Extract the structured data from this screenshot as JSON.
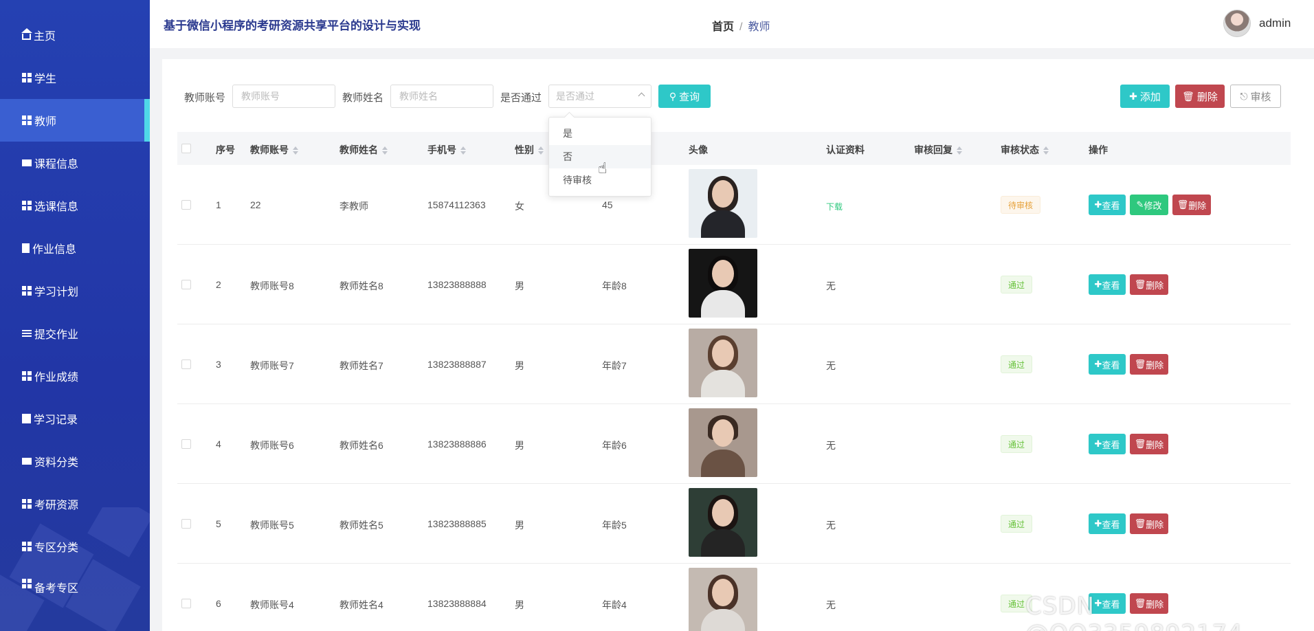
{
  "app": {
    "title": "基于微信小程序的考研资源共享平台的设计与实现",
    "user_name": "admin"
  },
  "breadcrumb": {
    "home": "首页",
    "separator": "/",
    "current": "教师"
  },
  "sidebar": {
    "items": [
      {
        "label": "主页",
        "icon": "home-icon"
      },
      {
        "label": "学生",
        "icon": "grid-icon"
      },
      {
        "label": "教师",
        "icon": "grid-icon",
        "active": true
      },
      {
        "label": "课程信息",
        "icon": "monitor-icon"
      },
      {
        "label": "选课信息",
        "icon": "grid-icon"
      },
      {
        "label": "作业信息",
        "icon": "clipboard-icon"
      },
      {
        "label": "学习计划",
        "icon": "grid-icon"
      },
      {
        "label": "提交作业",
        "icon": "sliders-icon"
      },
      {
        "label": "作业成绩",
        "icon": "grid-icon"
      },
      {
        "label": "学习记录",
        "icon": "book-icon"
      },
      {
        "label": "资料分类",
        "icon": "monitor-icon"
      },
      {
        "label": "考研资源",
        "icon": "grid-icon"
      },
      {
        "label": "专区分类",
        "icon": "grid-icon"
      },
      {
        "label": "备考专区",
        "icon": "grid-icon"
      }
    ]
  },
  "search": {
    "account_label": "教师账号",
    "account_placeholder": "教师账号",
    "name_label": "教师姓名",
    "name_placeholder": "教师姓名",
    "pass_label": "是否通过",
    "pass_placeholder": "是否通过",
    "query_button": "查询",
    "options": [
      "是",
      "否",
      "待审核"
    ]
  },
  "toolbar": {
    "add": "添加",
    "delete": "删除",
    "audit": "审核"
  },
  "table": {
    "columns": [
      "序号",
      "教师账号",
      "教师姓名",
      "手机号",
      "性别",
      "头像",
      "认证资料",
      "审核回复",
      "审核状态",
      "操作"
    ],
    "rows": [
      {
        "index": "1",
        "account": "22",
        "name": "李教师",
        "phone": "15874112363",
        "gender": "女",
        "age": "45",
        "cert": "下载",
        "reply": "",
        "status": "待审核"
      },
      {
        "index": "2",
        "account": "教师账号8",
        "name": "教师姓名8",
        "phone": "13823888888",
        "gender": "男",
        "age": "年龄8",
        "cert": "无",
        "reply": "",
        "status": "通过"
      },
      {
        "index": "3",
        "account": "教师账号7",
        "name": "教师姓名7",
        "phone": "13823888887",
        "gender": "男",
        "age": "年龄7",
        "cert": "无",
        "reply": "",
        "status": "通过"
      },
      {
        "index": "4",
        "account": "教师账号6",
        "name": "教师姓名6",
        "phone": "13823888886",
        "gender": "男",
        "age": "年龄6",
        "cert": "无",
        "reply": "",
        "status": "通过"
      },
      {
        "index": "5",
        "account": "教师账号5",
        "name": "教师姓名5",
        "phone": "13823888885",
        "gender": "男",
        "age": "年龄5",
        "cert": "无",
        "reply": "",
        "status": "通过"
      },
      {
        "index": "6",
        "account": "教师账号4",
        "name": "教师姓名4",
        "phone": "13823888884",
        "gender": "男",
        "age": "年龄4",
        "cert": "无",
        "reply": "",
        "status": "通过"
      }
    ],
    "actions": {
      "view": "查看",
      "edit": "修改",
      "delete": "删除"
    }
  },
  "watermark": "CSDN @QQ3359892174",
  "colors": {
    "sidebar": "#2541b2",
    "accent_teal": "#2ec8c8",
    "danger": "#c0474f",
    "success": "#2ec87e"
  }
}
